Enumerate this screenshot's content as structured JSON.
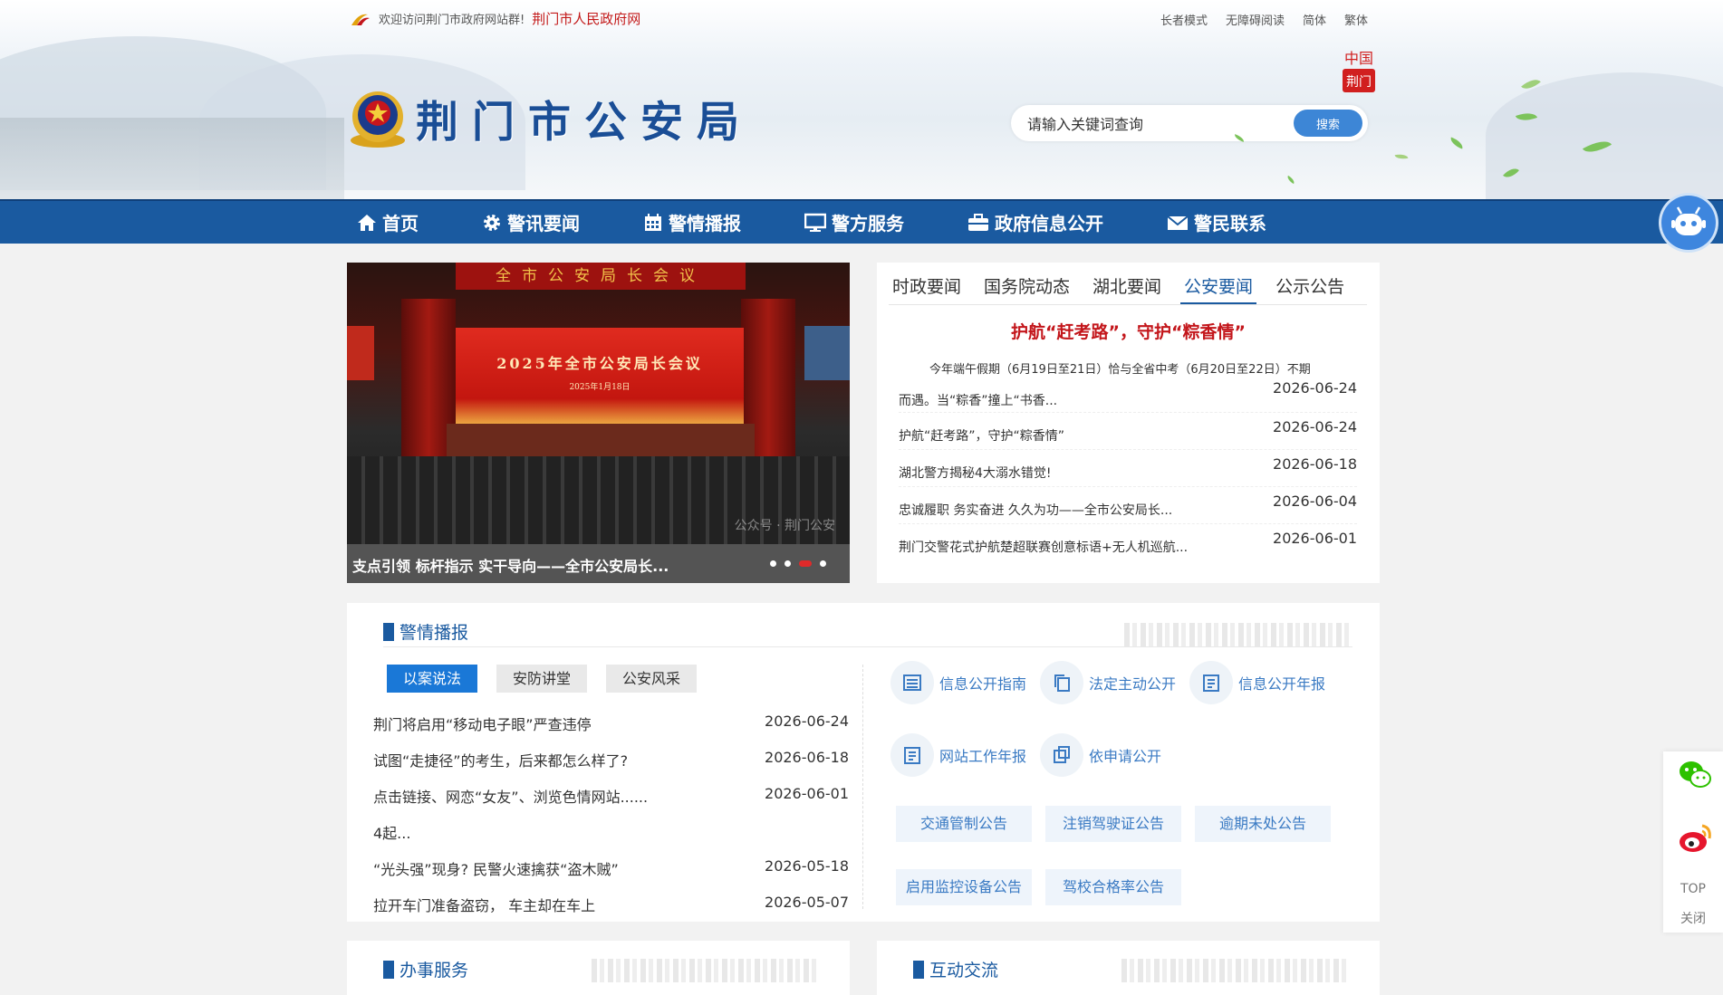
{
  "header": {
    "welcome": "欢迎访问荆门市政府网站群!",
    "gov_link": "荆门市人民政府网",
    "links": [
      "长者模式",
      "无障碍阅读",
      "简体",
      "繁体"
    ],
    "title": "荆门市公安局",
    "seal_text_top": "中国",
    "seal_text_bottom": "荆门",
    "search": {
      "placeholder": "请输入关键词查询",
      "button": "搜索"
    }
  },
  "nav": {
    "items": [
      {
        "label": "首页",
        "icon": "home-icon"
      },
      {
        "label": "警讯要闻",
        "icon": "gear-icon"
      },
      {
        "label": "警情播报",
        "icon": "calendar-icon"
      },
      {
        "label": "警方服务",
        "icon": "monitor-icon"
      },
      {
        "label": "政府信息公开",
        "icon": "briefcase-icon"
      },
      {
        "label": "警民联系",
        "icon": "mail-icon"
      }
    ],
    "bg_color": "#1a5aa0"
  },
  "slider": {
    "banner_text": "全市公安局长会议",
    "screen_title": "2025年全市公安局长会议",
    "screen_sub": "2025年1月18日",
    "watermark": "公众号 · 荆门公安",
    "caption": "支点引领 标杆指示 实干导向——全市公安局长...",
    "dot_count": 4,
    "active_dot": 3
  },
  "news": {
    "tabs": [
      "时政要闻",
      "国务院动态",
      "湖北要闻",
      "公安要闻",
      "公示公告"
    ],
    "active_tab": 3,
    "headline": "护航“赶考路”，守护“粽香情”",
    "summary": "今年端午假期（6月19日至21日）恰与全省中考（6月20日至22日）不期",
    "items": [
      {
        "title": "而遇。当“粽香”撞上“书香...",
        "date": "2026-06-24"
      },
      {
        "title": "护航“赶考路”，守护“粽香情”",
        "date": "2026-06-24"
      },
      {
        "title": "湖北警方揭秘4大溺水错觉!",
        "date": "2026-06-18"
      },
      {
        "title": "忠诚履职 务实奋进 久久为功——全市公安局长...",
        "date": "2026-06-04"
      },
      {
        "title": "荆门交警花式护航楚超联赛创意标语+无人机巡航...",
        "date": "2026-06-01"
      }
    ]
  },
  "police": {
    "title": "警情播报",
    "tabs": [
      "以案说法",
      "安防讲堂",
      "公安风采"
    ],
    "active_tab": 0,
    "items": [
      {
        "title": "荆门将启用“移动电子眼”严查违停",
        "date": "2026-06-24"
      },
      {
        "title": "试图“走捷径”的考生，后来都怎么样了?",
        "date": "2026-06-18"
      },
      {
        "title": "点击链接、网恋“女友”、浏览色情网站......",
        "date": "2026-06-01"
      },
      {
        "title": "4起...",
        "date": ""
      },
      {
        "title": "“光头强”现身? 民警火速擒获“盗木贼”",
        "date": "2026-05-18"
      },
      {
        "title": "拉开车门准备盗窃， 车主却在车上",
        "date": "2026-05-07"
      }
    ],
    "quick_links": [
      {
        "label": "信息公开指南",
        "icon": "list-icon"
      },
      {
        "label": "法定主动公开",
        "icon": "copy-icon"
      },
      {
        "label": "信息公开年报",
        "icon": "report-icon"
      },
      {
        "label": "网站工作年报",
        "icon": "report-icon"
      },
      {
        "label": "依申请公开",
        "icon": "apply-icon"
      }
    ],
    "notices": [
      "交通管制公告",
      "注销驾驶证公告",
      "逾期未处公告",
      "启用监控设备公告",
      "驾校合格率公告"
    ]
  },
  "bottom": {
    "left_title": "办事服务",
    "right_title": "互动交流"
  },
  "float": {
    "wechat": "wechat-icon",
    "weibo": "weibo-icon",
    "top": "TOP",
    "close": "关闭"
  }
}
